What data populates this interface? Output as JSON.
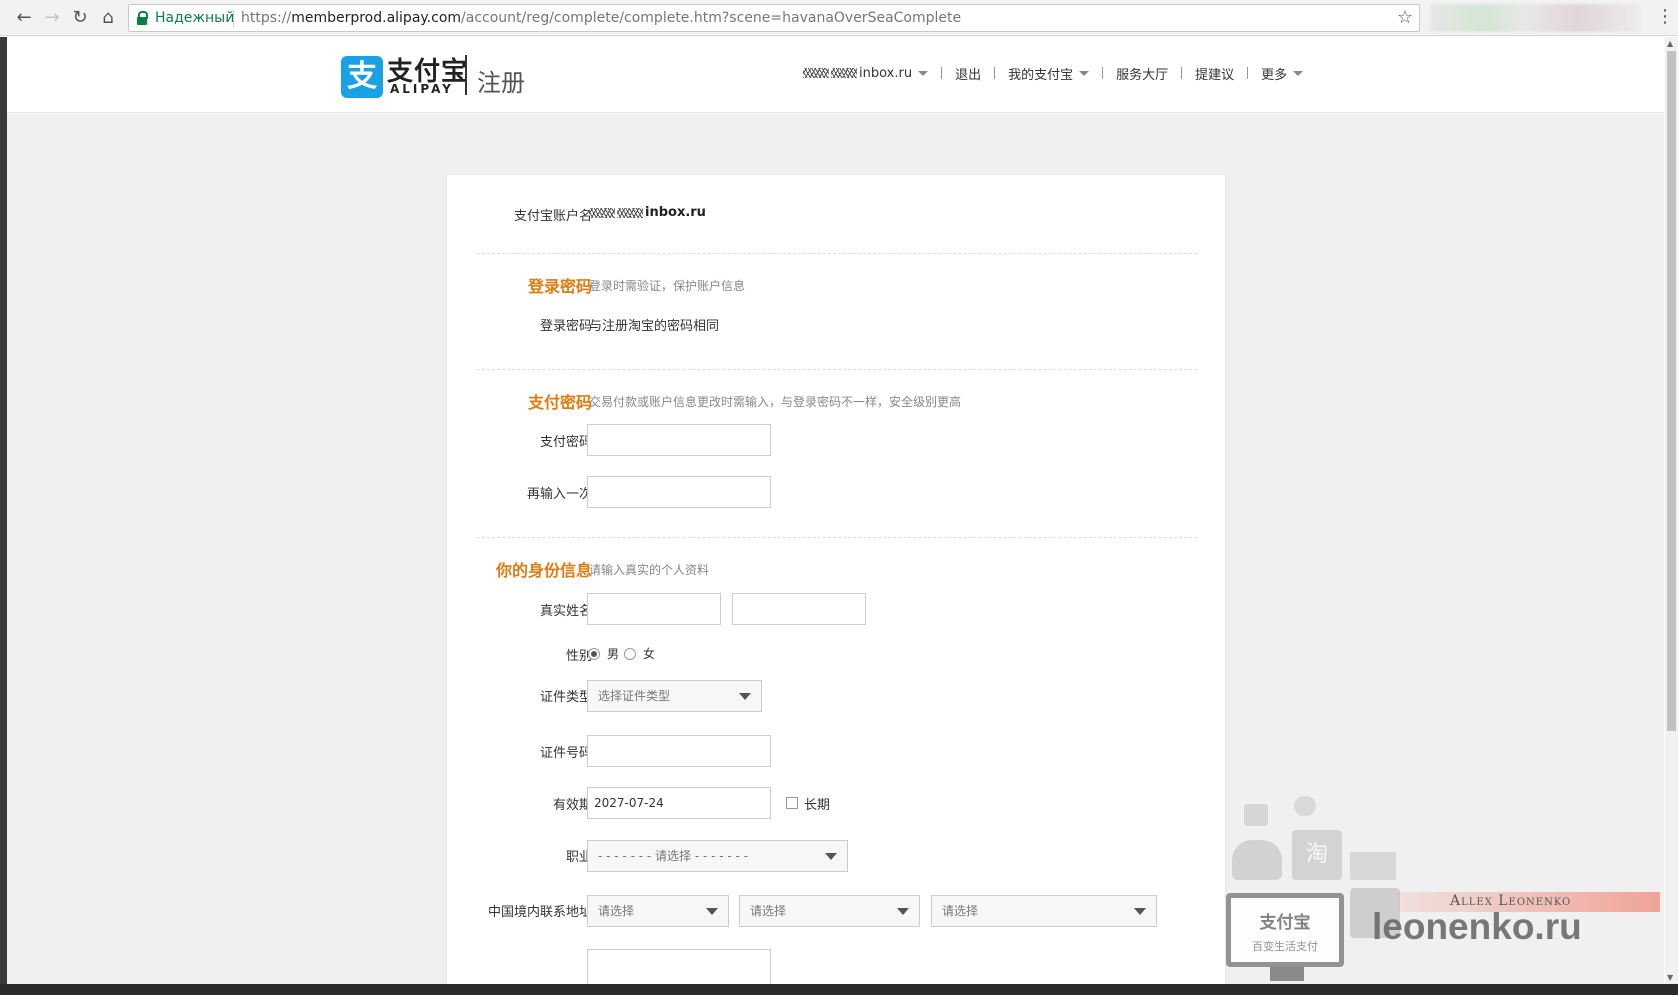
{
  "browser": {
    "secure_label": "Надежный",
    "url_scheme": "https://",
    "url_host": "memberprod.alipay.com",
    "url_path": "/account/reg/complete/complete.htm?scene=havanaOverSeaComplete"
  },
  "header": {
    "logo_cn": "支付宝",
    "logo_en": "ALIPAY",
    "page_label": "注册",
    "nav": {
      "account": "inbox.ru",
      "logout": "退出",
      "my_alipay": "我的支付宝",
      "service": "服务大厅",
      "suggest": "提建议",
      "more": "更多"
    }
  },
  "form": {
    "account": {
      "label": "支付宝账户名",
      "value": "inbox.ru"
    },
    "login_section": {
      "title": "登录密码",
      "desc": "登录时需验证，保护账户信息",
      "field_label": "登录密码",
      "field_value": "与注册淘宝的密码相同"
    },
    "pay_section": {
      "title": "支付密码",
      "desc": "交易付款或账户信息更改时需输入，与登录密码不一样，安全级别更高",
      "password_label": "支付密码",
      "confirm_label": "再输入一次"
    },
    "identity_section": {
      "title": "你的身份信息",
      "desc": "请输入真实的个人资料",
      "name_label": "真实姓名",
      "gender_label": "性别",
      "gender_male": "男",
      "gender_female": "女",
      "id_type_label": "证件类型",
      "id_type_value": "选择证件类型",
      "id_number_label": "证件号码",
      "expiry_label": "有效期",
      "expiry_value": "2027-07-24",
      "long_term_label": "长期",
      "job_label": "职业",
      "job_value": "- - - - - - - 请选择 - - - - - - -",
      "address_label": "中国境内联系地址",
      "province_value": "请选择",
      "city_value": "请选择",
      "district_value": "请选择"
    }
  },
  "watermark": {
    "monitor_title": "支付宝",
    "monitor_sub": "百变生活支付",
    "author": "Allex Leonenko",
    "site": "leonenko.ru"
  },
  "colors": {
    "section_title": "#e07b12",
    "logo_blue": "#1aa0e4",
    "secure_green": "#0b8043"
  }
}
